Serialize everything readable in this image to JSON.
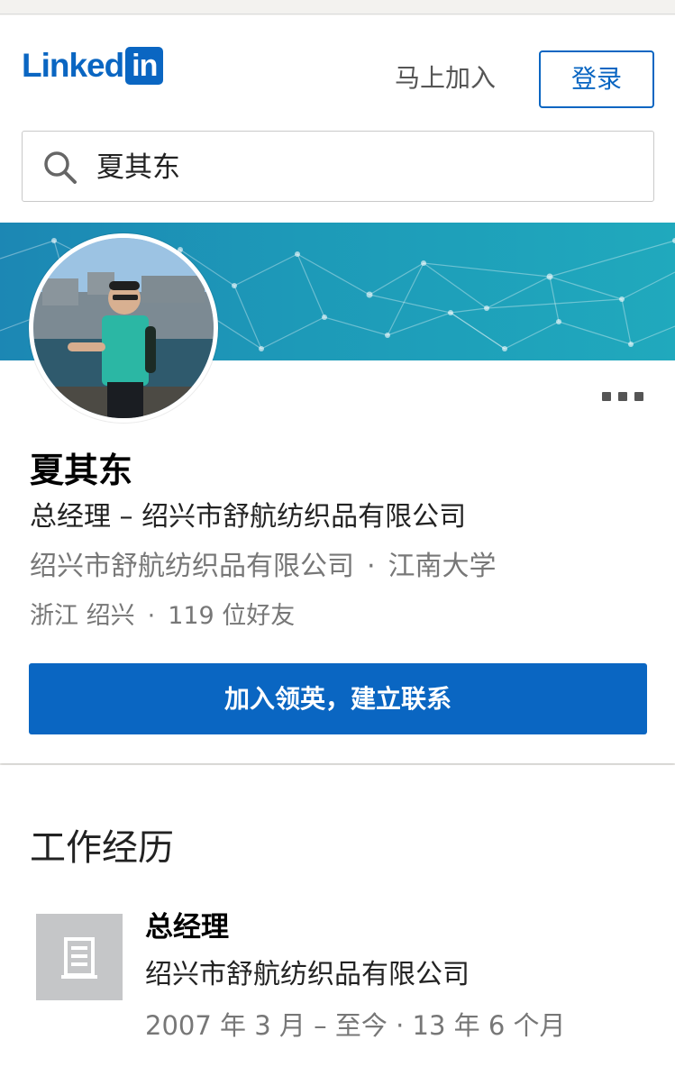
{
  "header": {
    "logo_text": "Linked",
    "logo_in": "in",
    "join_label": "马上加入",
    "signin_label": "登录"
  },
  "search": {
    "value": "夏其东",
    "icon": "search-icon"
  },
  "profile": {
    "name": "夏其东",
    "headline": "总经理 – 绍兴市舒航纺织品有限公司",
    "company": "绍兴市舒航纺织品有限公司",
    "school": "江南大学",
    "location": "浙江 绍兴",
    "connections": "119 位好友",
    "separator": "·",
    "cta_label": "加入领英，建立联系",
    "more_icon": "more-icon"
  },
  "experience": {
    "section_title": "工作经历",
    "items": [
      {
        "title": "总经理",
        "company": "绍兴市舒航纺织品有限公司",
        "dates": "2007 年 3 月 – 至今 · 13 年 6 个月",
        "logo_icon": "building-icon"
      }
    ]
  },
  "colors": {
    "brand": "#0a66c2",
    "banner": "#1d9ab8",
    "muted_text": "#777777"
  }
}
